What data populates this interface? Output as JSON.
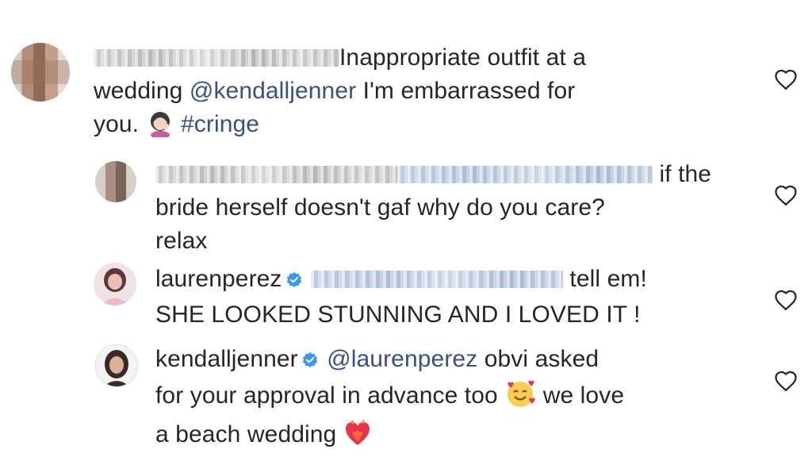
{
  "comments": [
    {
      "text_parts": [
        "Inappropriate outfit at a",
        "wedding",
        "@kendalljenner",
        "I'm embarrassed for",
        "you.",
        "#cringe"
      ],
      "emoji": "facepalm-woman-emoji",
      "liked": false
    },
    {
      "text_parts": [
        "if the",
        "bride herself doesn't gaf why do you care?",
        "relax"
      ],
      "liked": false
    },
    {
      "username": "laurenperez",
      "verified": true,
      "text_parts": [
        "tell em!",
        "SHE LOOKED STUNNING AND I LOVED IT !"
      ],
      "liked": false
    },
    {
      "username": "kendalljenner",
      "verified": true,
      "mention": "@laurenperez",
      "text_parts": [
        "obvi asked",
        "for your approval in advance too",
        "we love",
        "a beach wedding"
      ],
      "emojis": [
        "smiling-face-with-hearts-emoji",
        "heart-on-fire-emoji"
      ],
      "liked": false
    }
  ],
  "colors": {
    "text": "#262626",
    "link": "#385185",
    "verified": "#3897f0"
  }
}
